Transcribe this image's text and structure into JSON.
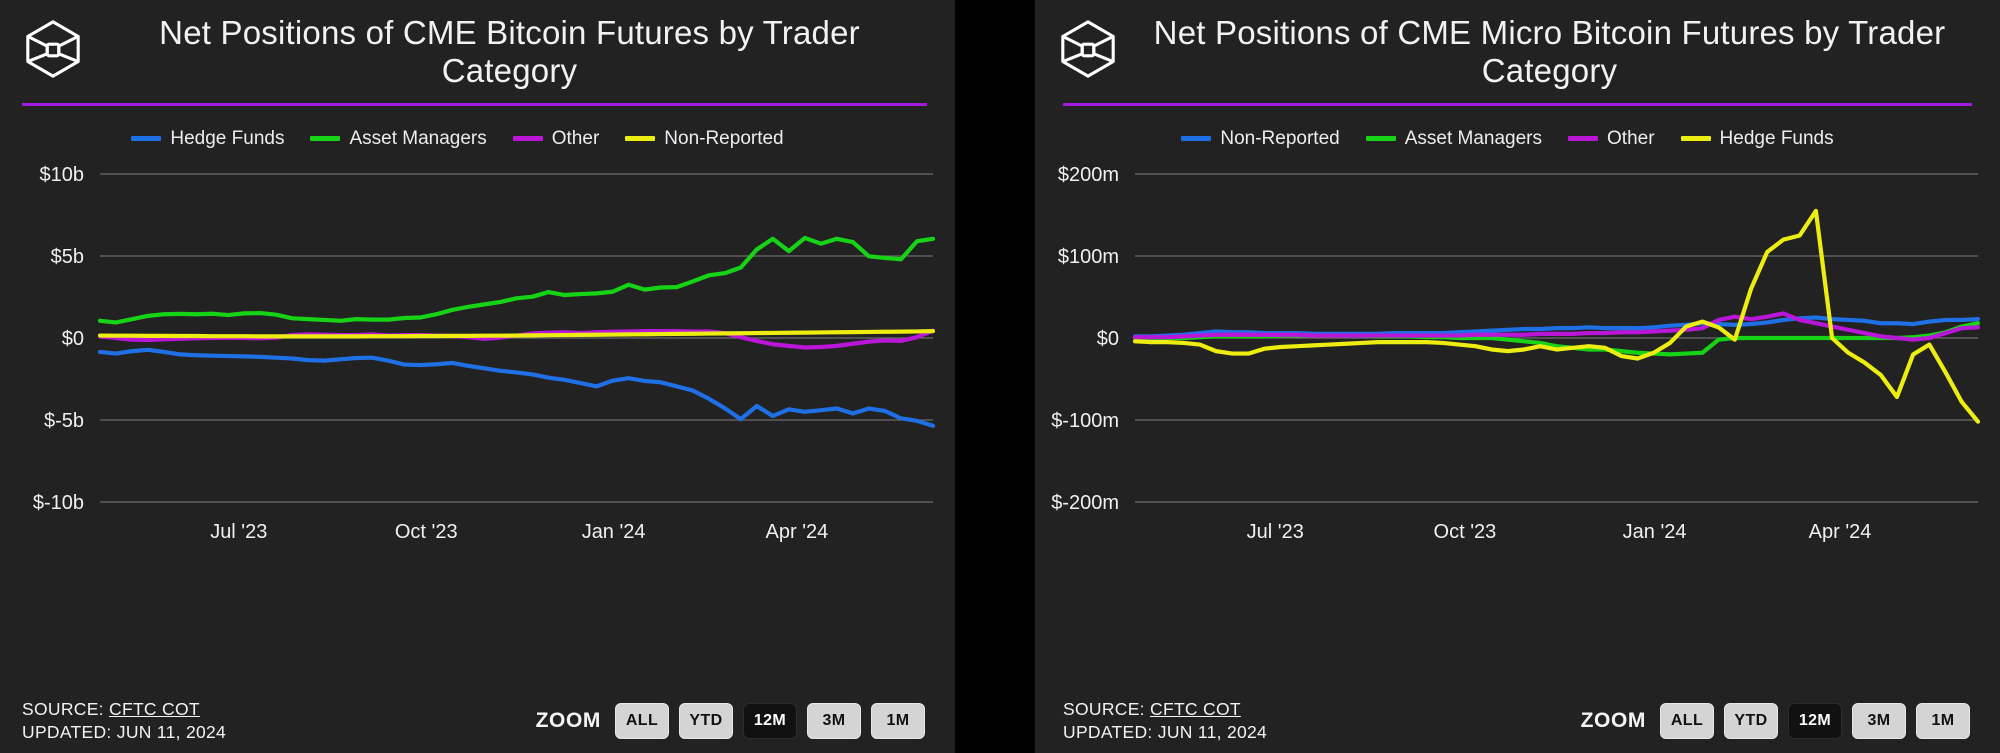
{
  "panels": [
    {
      "logo_icon": "hexagon-cube-logo-icon",
      "title": "Net Positions of CME Bitcoin Futures by Trader Category",
      "legend": [
        {
          "label": "Hedge Funds",
          "color": "#1f6fe5"
        },
        {
          "label": "Asset Managers",
          "color": "#16d316"
        },
        {
          "label": "Other",
          "color": "#b916d8"
        },
        {
          "label": "Non-Reported",
          "color": "#eded12"
        }
      ],
      "source_label": "SOURCE:",
      "source_value": "CFTC COT",
      "updated_label": "UPDATED:",
      "updated_value": "JUN 11, 2024",
      "zoom_caption": "ZOOM",
      "zoom_buttons": [
        {
          "label": "ALL",
          "active": false
        },
        {
          "label": "YTD",
          "active": false
        },
        {
          "label": "12M",
          "active": true
        },
        {
          "label": "3M",
          "active": false
        },
        {
          "label": "1M",
          "active": false
        }
      ],
      "chart_data": {
        "type": "line",
        "title": "Net Positions of CME Bitcoin Futures by Trader Category",
        "xlabel": "",
        "ylabel": "",
        "ylim": [
          -10,
          10
        ],
        "ytick_values": [
          10,
          5,
          0,
          -5,
          -10
        ],
        "ytick_labels": [
          "$10b",
          "$5b",
          "$0",
          "$-5b",
          "$-10b"
        ],
        "xtick_labels": [
          "Jul '23",
          "Oct '23",
          "Jan '24",
          "Apr '24"
        ],
        "xtick_positions": [
          0.145,
          0.37,
          0.595,
          0.815
        ],
        "grid": true,
        "legend_position": "top-center",
        "units": "billions USD",
        "n_points": 53,
        "series": [
          {
            "name": "Asset Managers",
            "color": "#16d316",
            "values": [
              1.05,
              0.95,
              1.15,
              1.35,
              1.45,
              1.47,
              1.45,
              1.48,
              1.4,
              1.5,
              1.52,
              1.42,
              1.2,
              1.15,
              1.1,
              1.05,
              1.15,
              1.12,
              1.12,
              1.22,
              1.25,
              1.45,
              1.72,
              1.9,
              2.05,
              2.2,
              2.42,
              2.52,
              2.8,
              2.62,
              2.68,
              2.72,
              2.82,
              3.25,
              2.95,
              3.08,
              3.1,
              3.45,
              3.82,
              3.95,
              4.3,
              5.4,
              6.05,
              5.3,
              6.1,
              5.75,
              6.05,
              5.85,
              4.98,
              4.88,
              4.8,
              5.9,
              6.05
            ]
          },
          {
            "name": "Other",
            "color": "#b916d8",
            "values": [
              0.1,
              0.0,
              -0.1,
              -0.12,
              -0.08,
              -0.05,
              -0.02,
              0.0,
              0.02,
              0.0,
              -0.02,
              0.02,
              0.18,
              0.22,
              0.2,
              0.18,
              0.18,
              0.22,
              0.15,
              0.18,
              0.18,
              0.15,
              0.12,
              0.05,
              -0.05,
              0.02,
              0.15,
              0.28,
              0.32,
              0.35,
              0.3,
              0.35,
              0.38,
              0.4,
              0.42,
              0.42,
              0.42,
              0.4,
              0.4,
              0.3,
              0.05,
              -0.18,
              -0.38,
              -0.48,
              -0.58,
              -0.55,
              -0.48,
              -0.35,
              -0.22,
              -0.15,
              -0.18,
              0.05,
              0.45
            ]
          },
          {
            "name": "Non-Reported",
            "color": "#eded12",
            "values": [
              0.15,
              0.14,
              0.14,
              0.13,
              0.13,
              0.12,
              0.12,
              0.11,
              0.11,
              0.11,
              0.1,
              0.1,
              0.1,
              0.1,
              0.1,
              0.1,
              0.1,
              0.11,
              0.11,
              0.11,
              0.12,
              0.12,
              0.13,
              0.13,
              0.14,
              0.14,
              0.15,
              0.16,
              0.17,
              0.18,
              0.19,
              0.2,
              0.21,
              0.22,
              0.23,
              0.24,
              0.25,
              0.26,
              0.27,
              0.28,
              0.29,
              0.3,
              0.31,
              0.32,
              0.33,
              0.34,
              0.35,
              0.36,
              0.37,
              0.38,
              0.39,
              0.4,
              0.42
            ]
          },
          {
            "name": "Hedge Funds",
            "color": "#1f6fe5",
            "values": [
              -0.85,
              -0.95,
              -0.8,
              -0.72,
              -0.85,
              -1.0,
              -1.05,
              -1.08,
              -1.1,
              -1.12,
              -1.15,
              -1.2,
              -1.25,
              -1.35,
              -1.38,
              -1.3,
              -1.22,
              -1.2,
              -1.38,
              -1.62,
              -1.65,
              -1.6,
              -1.52,
              -1.7,
              -1.85,
              -2.0,
              -2.1,
              -2.22,
              -2.42,
              -2.55,
              -2.75,
              -2.95,
              -2.6,
              -2.45,
              -2.62,
              -2.7,
              -2.95,
              -3.2,
              -3.7,
              -4.28,
              -4.95,
              -4.15,
              -4.75,
              -4.35,
              -4.5,
              -4.4,
              -4.3,
              -4.6,
              -4.3,
              -4.45,
              -4.9,
              -5.05,
              -5.35
            ]
          }
        ]
      }
    },
    {
      "logo_icon": "hexagon-cube-logo-icon",
      "title": "Net Positions of CME Micro Bitcoin Futures by Trader Category",
      "legend": [
        {
          "label": "Non-Reported",
          "color": "#1f6fe5"
        },
        {
          "label": "Asset Managers",
          "color": "#16d316"
        },
        {
          "label": "Other",
          "color": "#b916d8"
        },
        {
          "label": "Hedge Funds",
          "color": "#eded12"
        }
      ],
      "source_label": "SOURCE:",
      "source_value": "CFTC COT",
      "updated_label": "UPDATED:",
      "updated_value": "JUN 11, 2024",
      "zoom_caption": "ZOOM",
      "zoom_buttons": [
        {
          "label": "ALL",
          "active": false
        },
        {
          "label": "YTD",
          "active": false
        },
        {
          "label": "12M",
          "active": true
        },
        {
          "label": "3M",
          "active": false
        },
        {
          "label": "1M",
          "active": false
        }
      ],
      "chart_data": {
        "type": "line",
        "title": "Net Positions of CME Micro Bitcoin Futures by Trader Category",
        "xlabel": "",
        "ylabel": "",
        "ylim": [
          -200,
          200
        ],
        "ytick_values": [
          200,
          100,
          0,
          -100,
          -200
        ],
        "ytick_labels": [
          "$200m",
          "$100m",
          "$0",
          "$-100m",
          "$-200m"
        ],
        "xtick_labels": [
          "Jul '23",
          "Oct '23",
          "Jan '24",
          "Apr '24"
        ],
        "xtick_positions": [
          0.145,
          0.37,
          0.595,
          0.815
        ],
        "grid": true,
        "legend_position": "top-center",
        "units": "millions USD",
        "n_points": 53,
        "series": [
          {
            "name": "Non-Reported",
            "color": "#1f6fe5",
            "values": [
              2,
              2,
              3,
              4,
              6,
              8,
              7,
              7,
              6,
              6,
              6,
              5,
              5,
              5,
              5,
              5,
              6,
              6,
              6,
              6,
              7,
              8,
              9,
              10,
              11,
              11,
              12,
              12,
              13,
              12,
              12,
              12,
              13,
              15,
              16,
              18,
              17,
              16,
              17,
              19,
              22,
              24,
              25,
              23,
              22,
              21,
              18,
              18,
              17,
              20,
              22,
              22,
              23
            ]
          },
          {
            "name": "Asset Managers",
            "color": "#16d316",
            "values": [
              0,
              0,
              0,
              0,
              1,
              2,
              2,
              2,
              2,
              3,
              3,
              3,
              3,
              3,
              3,
              2,
              2,
              2,
              1,
              1,
              0,
              0,
              0,
              -2,
              -4,
              -6,
              -10,
              -12,
              -14,
              -14,
              -16,
              -18,
              -19,
              -20,
              -19,
              -18,
              -2,
              0,
              0,
              0,
              0,
              0,
              0,
              0,
              0,
              0,
              0,
              0,
              1,
              3,
              7,
              14,
              18
            ]
          },
          {
            "name": "Other",
            "color": "#b916d8",
            "values": [
              1,
              1,
              1,
              2,
              3,
              4,
              4,
              4,
              4,
              4,
              4,
              3,
              3,
              3,
              3,
              3,
              3,
              3,
              3,
              3,
              3,
              4,
              4,
              4,
              4,
              5,
              5,
              5,
              6,
              6,
              7,
              7,
              8,
              9,
              10,
              12,
              22,
              26,
              23,
              26,
              30,
              22,
              18,
              14,
              10,
              6,
              2,
              0,
              -2,
              0,
              6,
              12,
              13
            ]
          },
          {
            "name": "Hedge Funds",
            "color": "#eded12",
            "values": [
              -4,
              -5,
              -5,
              -6,
              -8,
              -16,
              -19,
              -19,
              -13,
              -11,
              -10,
              -9,
              -8,
              -7,
              -6,
              -5,
              -5,
              -5,
              -5,
              -6,
              -8,
              -10,
              -14,
              -16,
              -14,
              -10,
              -14,
              -12,
              -10,
              -12,
              -22,
              -25,
              -18,
              -6,
              14,
              20,
              13,
              -2,
              60,
              105,
              120,
              125,
              155,
              0,
              -18,
              -30,
              -45,
              -72,
              -20,
              -8,
              -42,
              -78,
              -102
            ]
          }
        ]
      }
    }
  ]
}
